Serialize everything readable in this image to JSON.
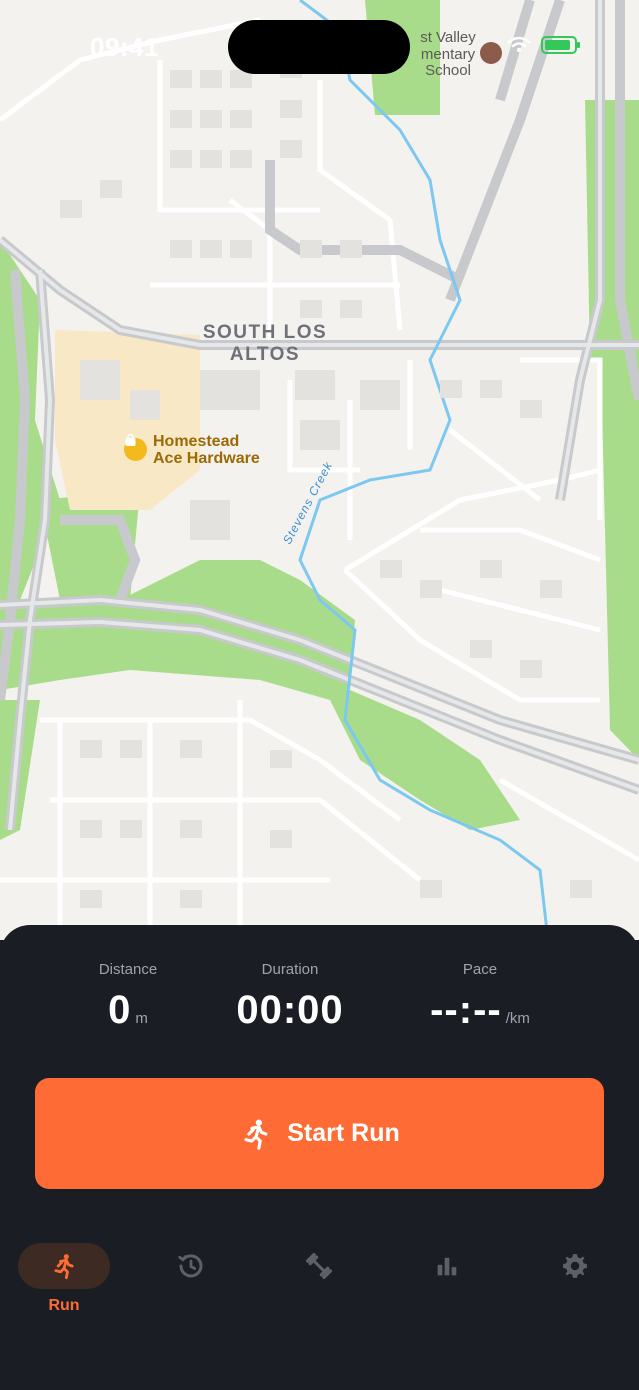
{
  "status_bar": {
    "time": "09:41",
    "battery_level": 0.9,
    "icons": [
      "cellular-icon",
      "wifi-icon",
      "battery-icon"
    ]
  },
  "map": {
    "area_label": "SOUTH LOS\nALTOS",
    "poi": {
      "name_line1": "Homestead",
      "name_line2": "Ace Hardware",
      "icon": "shopping-bag-icon"
    },
    "school": {
      "line1": "st Valley",
      "line2": "mentary",
      "line3": "School",
      "icon": "school-icon"
    },
    "creek": "Stevens Creek"
  },
  "stats": {
    "distance": {
      "label": "Distance",
      "value": "0",
      "unit": "m"
    },
    "duration": {
      "label": "Duration",
      "value": "00:00"
    },
    "pace": {
      "label": "Pace",
      "value": "--:--",
      "unit": "/km"
    }
  },
  "start_button": {
    "label": "Start Run",
    "icon": "runner-icon"
  },
  "tabs": [
    {
      "key": "run",
      "label": "Run",
      "icon": "runner-icon",
      "active": true
    },
    {
      "key": "history",
      "label": "",
      "icon": "history-icon",
      "active": false
    },
    {
      "key": "workouts",
      "label": "",
      "icon": "dumbbell-icon",
      "active": false
    },
    {
      "key": "stats",
      "label": "",
      "icon": "bar-chart-icon",
      "active": false
    },
    {
      "key": "settings",
      "label": "",
      "icon": "gear-icon",
      "active": false
    }
  ],
  "colors": {
    "accent": "#ff6b35",
    "panel_bg": "#1a1d24",
    "map_bg": "#f4f2ee",
    "park": "#a9dc8a",
    "water": "#7cc8f0",
    "inactive_icon": "#5c6068"
  }
}
